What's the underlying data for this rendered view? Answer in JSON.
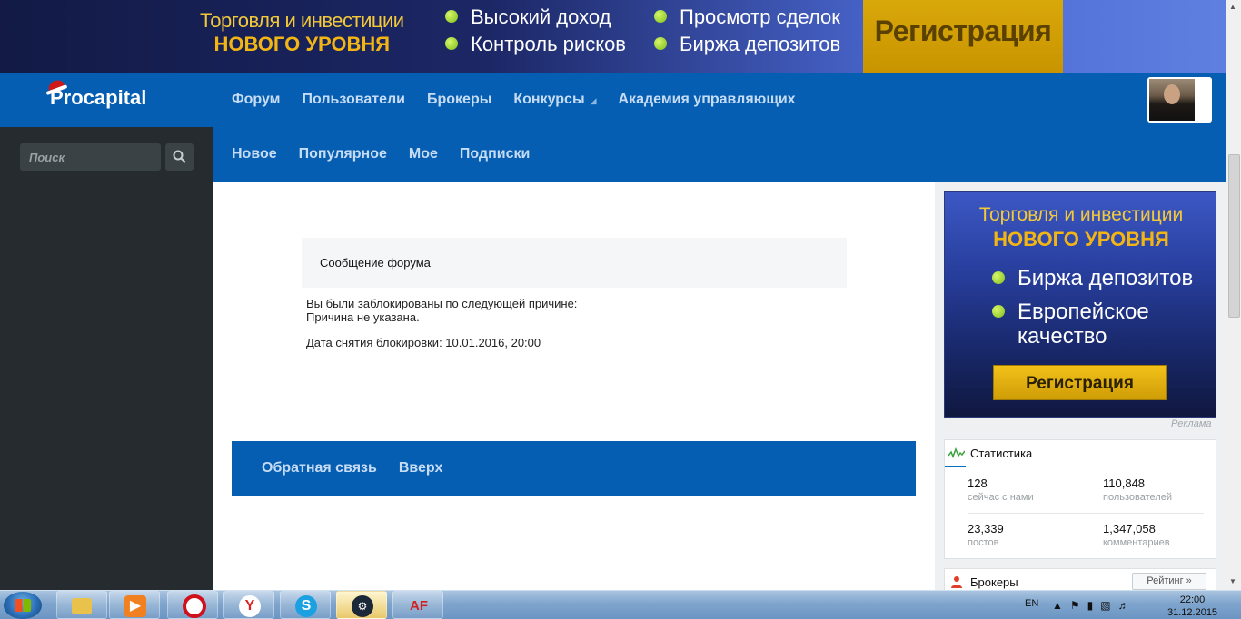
{
  "top_banner": {
    "headline_1": "Торговля и инвестиции",
    "headline_2": "НОВОГО УРОВНЯ",
    "bullets_col1": [
      "Высокий доход",
      "Контроль рисков"
    ],
    "bullets_col2": [
      "Просмотр сделок",
      "Биржа депозитов"
    ],
    "register_label": "Регистрация"
  },
  "header": {
    "logo": "Procapital",
    "nav": [
      "Форум",
      "Пользователи",
      "Брокеры",
      "Конкурсы",
      "Академия управляющих"
    ],
    "accent": "#055eb1"
  },
  "sidebar": {
    "search_placeholder": "Поиск"
  },
  "sub_nav": [
    "Новое",
    "Популярное",
    "Мое",
    "Подписки"
  ],
  "message": {
    "title": "Сообщение форума",
    "line1": "Вы были заблокированы по следующей причине:",
    "line2": "Причина не указана.",
    "date_line": "Дата снятия блокировки: 10.01.2016, 20:00"
  },
  "footer_links": [
    "Обратная связь",
    "Вверх"
  ],
  "ad": {
    "headline_1": "Торговля и инвестиции",
    "headline_2": "НОВОГО УРОВНЯ",
    "bullet_1": "Биржа депозитов",
    "bullet_2a": "Европейское",
    "bullet_2b": "качество",
    "register_label": "Регистрация",
    "note": "Реклама"
  },
  "stats": {
    "title": "Статистика",
    "items": [
      {
        "value": "128",
        "label": "сейчас с нами"
      },
      {
        "value": "110,848",
        "label": "пользователей"
      },
      {
        "value": "23,339",
        "label": "постов"
      },
      {
        "value": "1,347,058",
        "label": "комментариев"
      }
    ]
  },
  "brokers": {
    "title": "Брокеры",
    "rating_button": "Рейтинг »"
  },
  "taskbar": {
    "lang": "EN",
    "time": "22:00",
    "date": "31.12.2015"
  }
}
